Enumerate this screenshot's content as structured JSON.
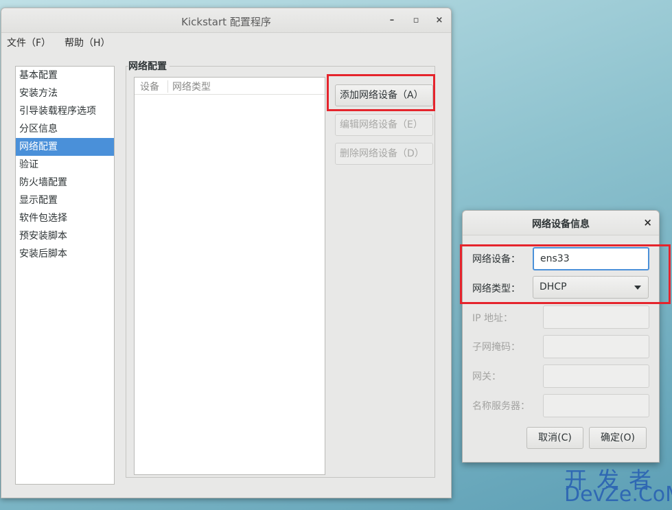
{
  "window": {
    "title": "Kickstart 配置程序",
    "controls": {
      "minimize": "–",
      "maximize": "▫",
      "close": "×"
    }
  },
  "menubar": {
    "items": [
      "文件（F）",
      "帮助（H）"
    ]
  },
  "sidebar": {
    "items": [
      "基本配置",
      "安装方法",
      "引导装载程序选项",
      "分区信息",
      "网络配置",
      "验证",
      "防火墙配置",
      "显示配置",
      "软件包选择",
      "预安装脚本",
      "安装后脚本"
    ],
    "selected_index": 4
  },
  "network_section": {
    "title": "网络配置",
    "columns": [
      "设备",
      "网络类型"
    ],
    "buttons": {
      "add": "添加网络设备（A）",
      "edit": "编辑网络设备（E）",
      "delete": "删除网络设备（D）"
    }
  },
  "dialog": {
    "title": "网络设备信息",
    "close_icon": "×",
    "fields": {
      "device_label": "网络设备：",
      "device_value": "ens33",
      "type_label": "网络类型：",
      "type_value": "DHCP",
      "ip_label": "IP 地址：",
      "netmask_label": "子网掩码：",
      "gateway_label": "网关：",
      "nameserver_label": "名称服务器："
    },
    "buttons": {
      "cancel": "取消(C)",
      "ok": "确定(O)"
    }
  },
  "watermark": {
    "top": "开发者",
    "bottom": "DevZe.CoM"
  },
  "colors": {
    "highlight": "#e5242c",
    "selection": "#4a90d9",
    "watermark": "#2f68b3"
  }
}
